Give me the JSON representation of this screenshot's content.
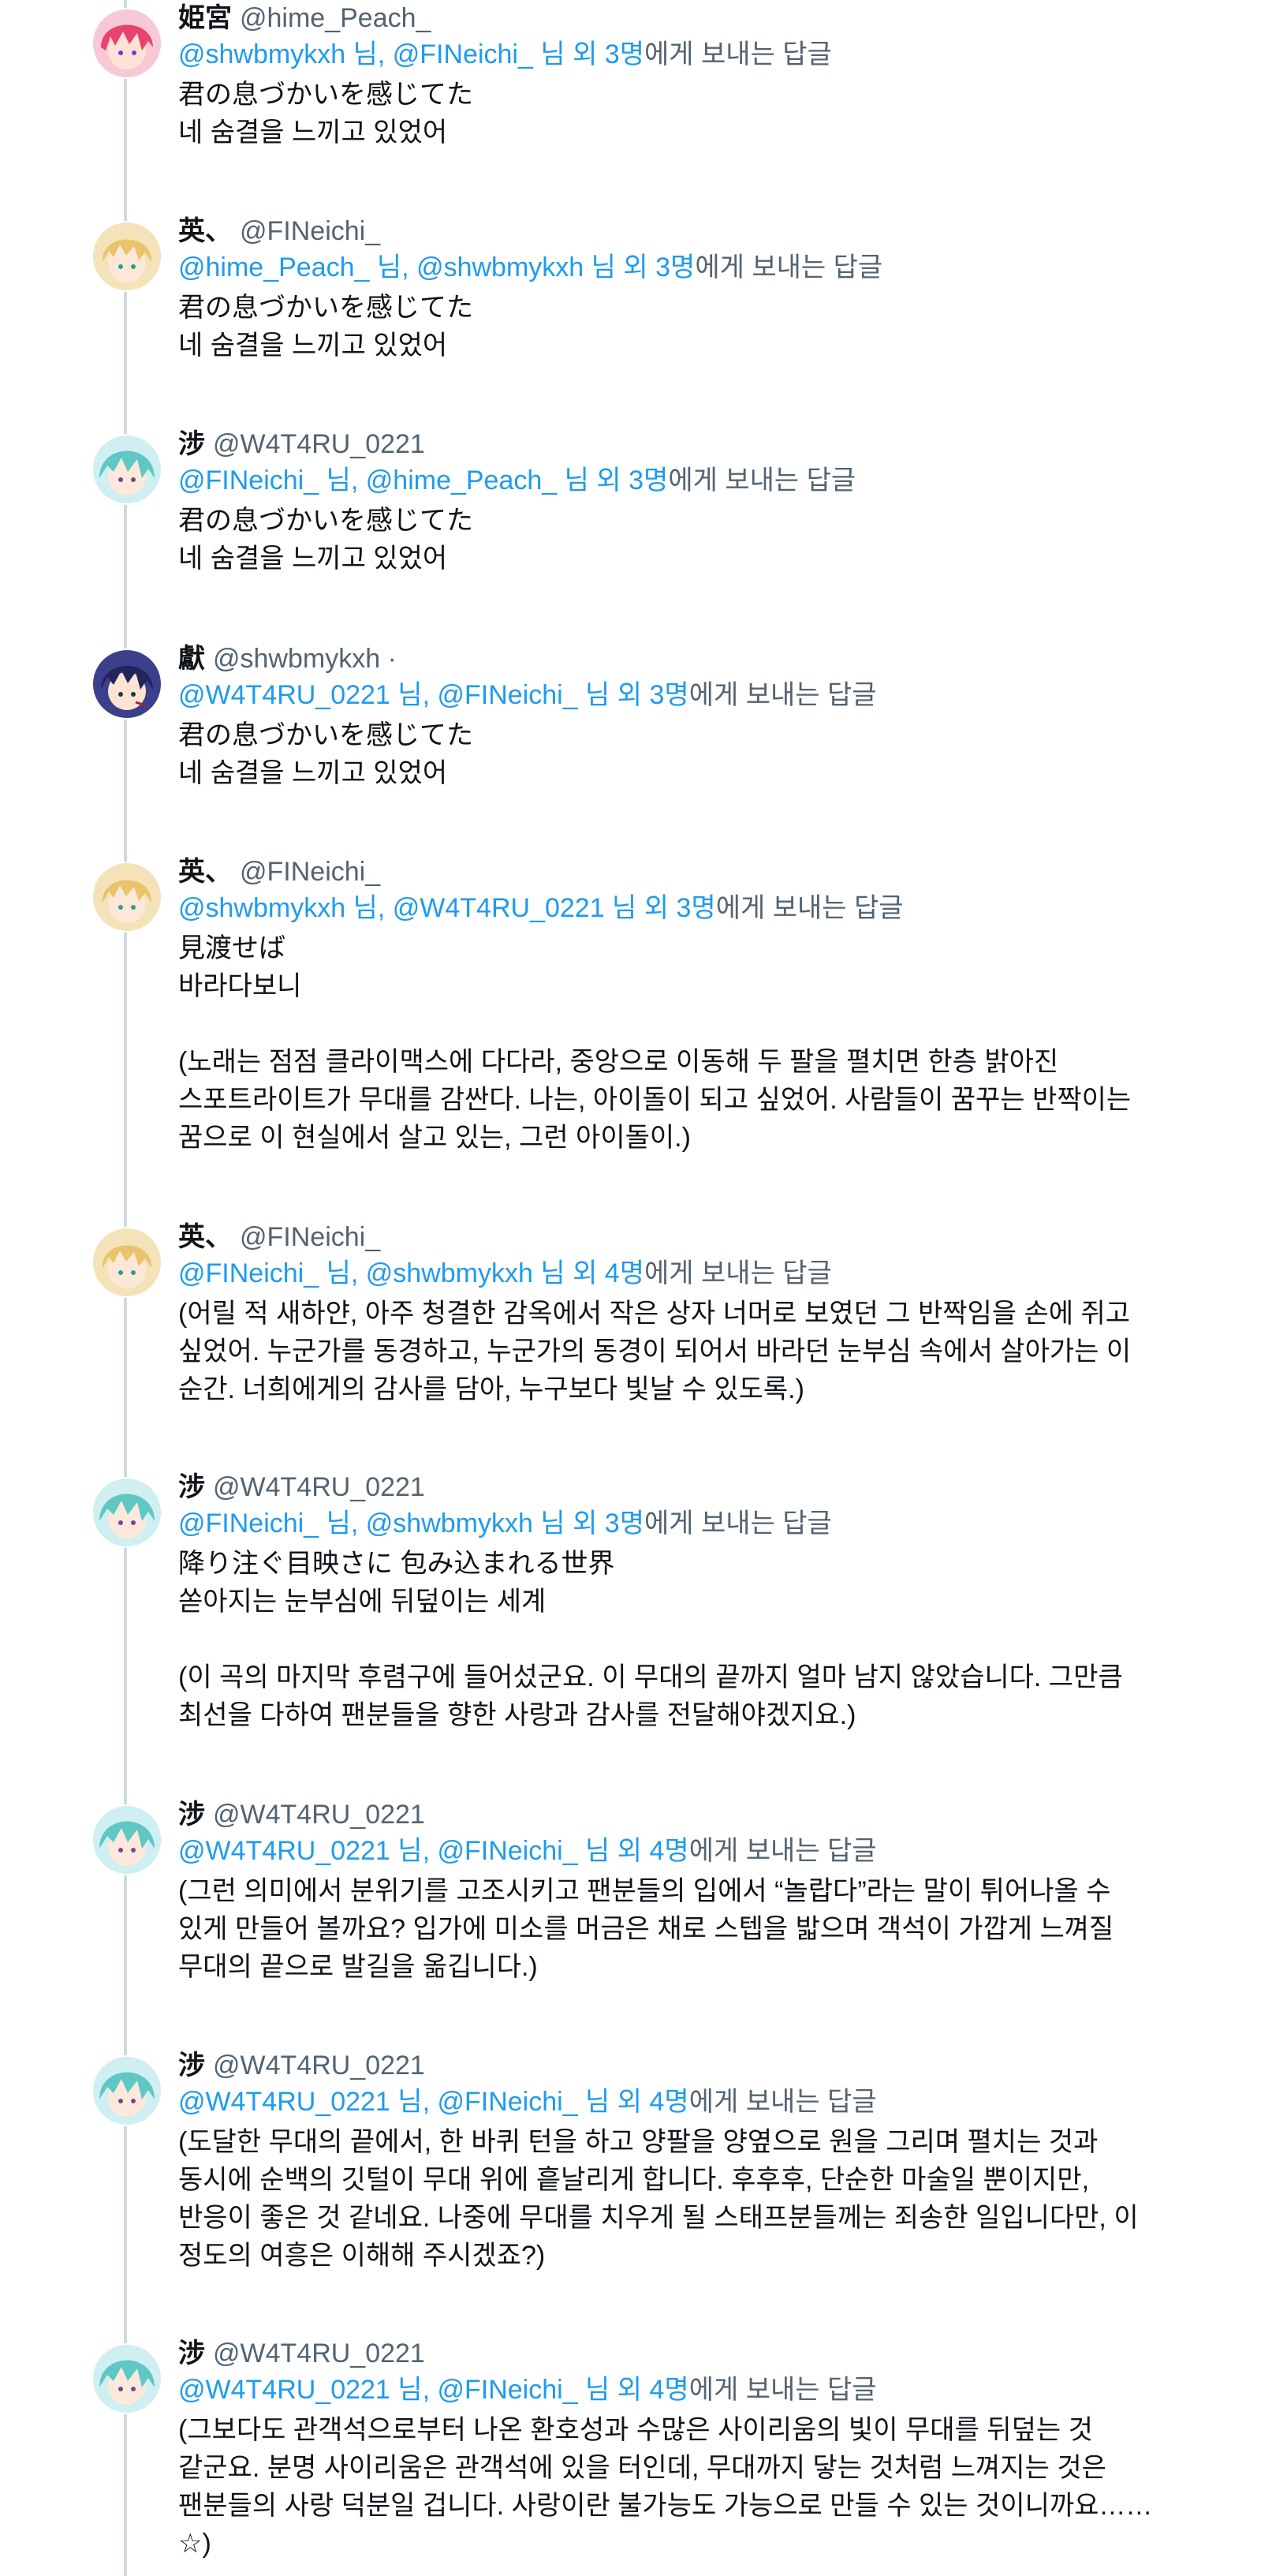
{
  "posts": [
    {
      "avatar": "pink-hair-avatar",
      "name": "姫宮",
      "handle": "@hime_Peach_",
      "reply": {
        "m1": "@shwbmykxh 님",
        "m2": "@FINeichi_ 님",
        "others": "외 3명",
        "suffix": "에게 보내는 답글"
      },
      "lines": [
        "君の息づかいを感じてた",
        "네 숨결을 느끼고 있었어"
      ]
    },
    {
      "avatar": "blonde-hair-avatar",
      "name": "英、",
      "handle": "@FINeichi_",
      "reply": {
        "m1": "@hime_Peach_ 님",
        "m2": "@shwbmykxh 님",
        "others": "외 3명",
        "suffix": "에게 보내는 답글"
      },
      "lines": [
        "君の息づかいを感じてた",
        "네 숨결을 느끼고 있었어"
      ]
    },
    {
      "avatar": "teal-hair-avatar",
      "name": "涉",
      "handle": "@W4T4RU_0221",
      "reply": {
        "m1": "@FINeichi_ 님",
        "m2": "@hime_Peach_ 님",
        "others": "외 3명",
        "suffix": "에게 보내는 답글"
      },
      "lines": [
        "君の息づかいを感じてた",
        "네 숨결을 느끼고 있었어"
      ]
    },
    {
      "avatar": "dark-hair-avatar",
      "name": "獻",
      "handle": "@shwbmykxh ·",
      "reply": {
        "m1": "@W4T4RU_0221 님",
        "m2": "@FINeichi_ 님",
        "others": "외 3명",
        "suffix": "에게 보내는 답글"
      },
      "lines": [
        "君の息づかいを感じてた",
        "네 숨결을 느끼고 있었어"
      ]
    },
    {
      "avatar": "blonde-hair-avatar",
      "name": "英、",
      "handle": "@FINeichi_",
      "reply": {
        "m1": "@shwbmykxh 님",
        "m2": "@W4T4RU_0221 님",
        "others": "외 3명",
        "suffix": "에게 보내는 답글"
      },
      "lines": [
        "見渡せば",
        "바라다보니",
        "",
        "(노래는 점점 클라이맥스에 다다라, 중앙으로 이동해 두 팔을 펼치면 한층 밝아진",
        "스포트라이트가 무대를 감싼다. 나는, 아이돌이 되고 싶었어. 사람들이 꿈꾸는 반짝이는",
        "꿈으로 이 현실에서 살고 있는, 그런 아이돌이.)"
      ]
    },
    {
      "avatar": "blonde-hair-avatar",
      "name": "英、",
      "handle": "@FINeichi_",
      "reply": {
        "m1": "@FINeichi_ 님",
        "m2": "@shwbmykxh 님",
        "others": "외 4명",
        "suffix": "에게 보내는 답글"
      },
      "lines": [
        "(어릴 적 새하얀, 아주 청결한 감옥에서 작은 상자 너머로 보였던 그 반짝임을 손에 쥐고",
        "싶었어. 누군가를 동경하고, 누군가의 동경이 되어서 바라던 눈부심 속에서 살아가는 이",
        "순간. 너희에게의 감사를 담아, 누구보다 빛날 수 있도록.)"
      ]
    },
    {
      "avatar": "teal-hair-avatar",
      "name": "涉",
      "handle": "@W4T4RU_0221",
      "reply": {
        "m1": "@FINeichi_ 님",
        "m2": "@shwbmykxh 님",
        "others": "외 3명",
        "suffix": "에게 보내는 답글"
      },
      "lines": [
        "降り注ぐ目映さに 包み込まれる世界",
        "쏟아지는 눈부심에 뒤덮이는 세계",
        "",
        "(이 곡의 마지막 후렴구에 들어섰군요. 이 무대의 끝까지 얼마 남지 않았습니다. 그만큼",
        "최선을 다하여 팬분들을 향한 사랑과 감사를 전달해야겠지요.)"
      ]
    },
    {
      "avatar": "teal-hair-avatar",
      "name": "涉",
      "handle": "@W4T4RU_0221",
      "reply": {
        "m1": "@W4T4RU_0221 님",
        "m2": "@FINeichi_ 님",
        "others": "외 4명",
        "suffix": "에게 보내는 답글"
      },
      "lines": [
        "(그런 의미에서 분위기를 고조시키고 팬분들의 입에서 “놀랍다”라는 말이 튀어나올 수",
        "있게 만들어 볼까요? 입가에 미소를 머금은 채로 스텝을 밟으며 객석이 가깝게 느껴질",
        "무대의 끝으로 발길을 옮깁니다.)"
      ]
    },
    {
      "avatar": "teal-hair-avatar",
      "name": "涉",
      "handle": "@W4T4RU_0221",
      "reply": {
        "m1": "@W4T4RU_0221 님",
        "m2": "@FINeichi_ 님",
        "others": "외 4명",
        "suffix": "에게 보내는 답글"
      },
      "lines": [
        "(도달한 무대의 끝에서, 한 바퀴 턴을 하고 양팔을 양옆으로 원을 그리며 펼치는 것과",
        "동시에 순백의 깃털이 무대 위에 흩날리게 합니다. 후후후, 단순한 마술일 뿐이지만,",
        "반응이 좋은 것 같네요. 나중에 무대를 치우게 될 스태프분들께는 죄송한 일입니다만, 이",
        "정도의 여흥은 이해해 주시겠죠?)"
      ]
    },
    {
      "avatar": "teal-hair-avatar",
      "name": "涉",
      "handle": "@W4T4RU_0221",
      "reply": {
        "m1": "@W4T4RU_0221 님",
        "m2": "@FINeichi_ 님",
        "others": "외 4명",
        "suffix": "에게 보내는 답글"
      },
      "lines": [
        "(그보다도 관객석으로부터 나온 환호성과 수많은 사이리움의 빛이 무대를 뒤덮는 것",
        "같군요. 분명 사이리움은 관객석에 있을 터인데, 무대까지 닿는 것처럼 느껴지는 것은",
        "팬분들의 사랑 덕분일 겁니다. 사랑이란 불가능도 가능으로 만들 수 있는 것이니까요……",
        "☆)"
      ]
    }
  ]
}
